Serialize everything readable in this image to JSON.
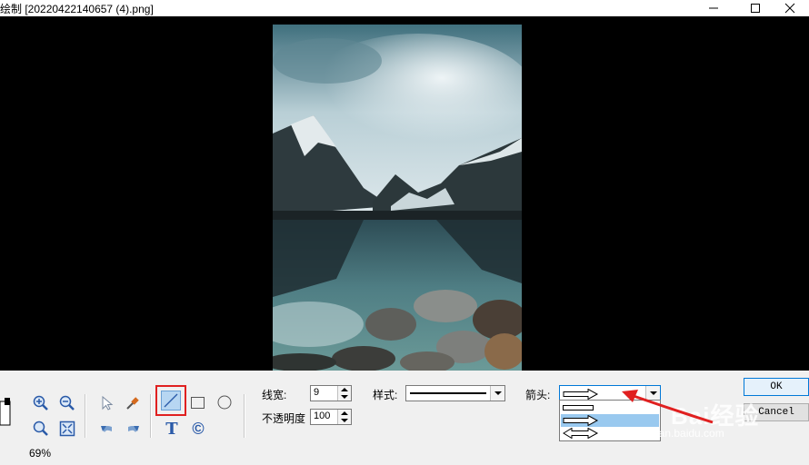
{
  "window": {
    "title": "绘制 [20220422140657 (4).png]",
    "controls": [
      "minimize-icon",
      "maximize-icon",
      "close-icon"
    ]
  },
  "status": {
    "zoom": "69%"
  },
  "toolbar": {
    "tools": {
      "zoom_in": "zoom-in-icon",
      "zoom_out": "zoom-out-icon",
      "magnifier": "magnifier-icon",
      "fit": "fit-to-window-icon",
      "select": "arrow-pointer-icon",
      "eyedropper": "eyedropper-icon",
      "undo": "undo-icon",
      "redo": "redo-icon",
      "line": "line-tool-icon",
      "rectangle": "rectangle-tool-icon",
      "ellipse": "ellipse-tool-icon",
      "text": "T",
      "copyright": "©"
    },
    "line_width": {
      "label": "线宽:",
      "value": "9"
    },
    "opacity": {
      "label": "不透明度",
      "value": "100"
    },
    "style": {
      "label": "样式:"
    },
    "arrow": {
      "label": "箭头:",
      "selected": "right-arrow",
      "options": [
        "none",
        "right-arrow",
        "double-arrow"
      ],
      "highlighted_index": 1
    },
    "ok_label": "OK",
    "cancel_label": "Cancel"
  },
  "watermark": {
    "text": "Bai经验",
    "url": "jingyan.baidu.com"
  },
  "colors": {
    "highlight_box": "#e02020",
    "selection": "#99c9ef",
    "annotation_arrow": "#e02020"
  }
}
